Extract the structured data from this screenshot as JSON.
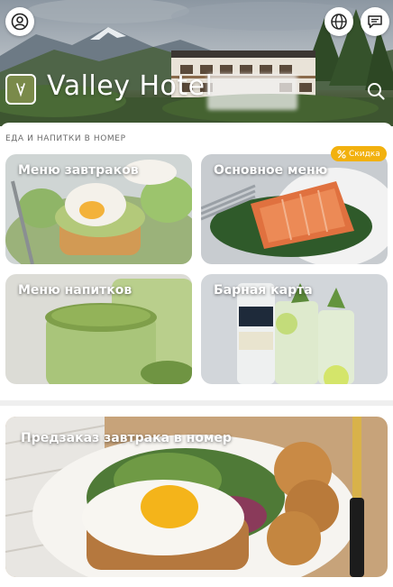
{
  "header": {
    "hotel_name": "Valley Hotel"
  },
  "section": {
    "label": "ЕДА И НАПИТКИ В НОМЕР"
  },
  "tiles": [
    {
      "title": "Меню завтраков"
    },
    {
      "title": "Основное меню",
      "badge": "Скидка"
    },
    {
      "title": "Меню напитков"
    },
    {
      "title": "Барная карта"
    }
  ],
  "preorder": {
    "title": "Предзаказ завтрака в номер"
  },
  "icons": {
    "profile": "user-circle-icon",
    "language": "globe-icon",
    "chat": "chat-bubble-icon",
    "search": "search-icon",
    "logo": "hotel-logo-icon",
    "discount": "percent-icon"
  },
  "colors": {
    "badge": "#f2b10e",
    "logo_bg": "#7a8a4a"
  }
}
